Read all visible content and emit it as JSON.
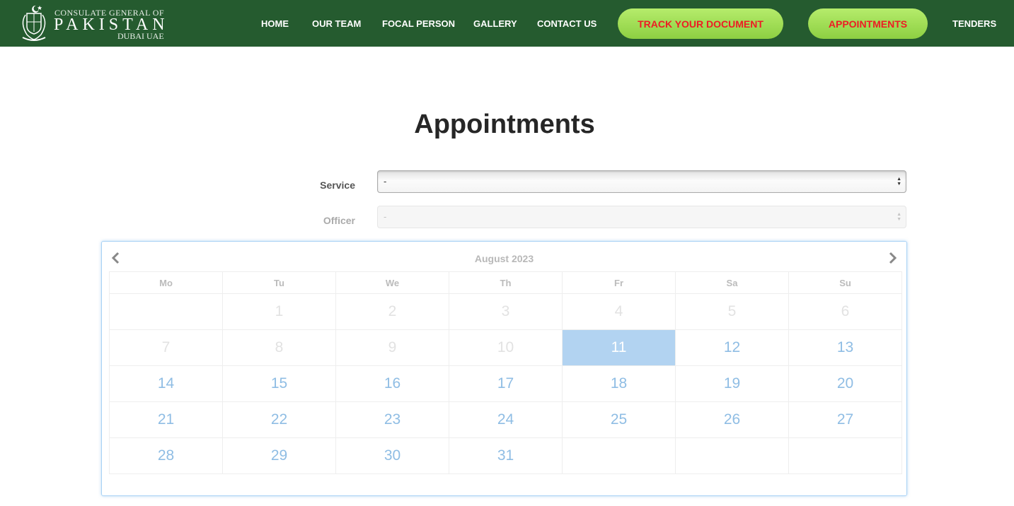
{
  "header": {
    "logo": {
      "line1": "CONSULATE GENERAL OF",
      "line2": "PAKISTAN",
      "line3": "DUBAI UAE"
    },
    "nav": {
      "home": "HOME",
      "our_team": "OUR TEAM",
      "focal_person": "FOCAL PERSON",
      "gallery": "GALLERY",
      "contact_us": "CONTACT US",
      "track": "TRACK YOUR DOCUMENT",
      "appointments": "APPOINTMENTS",
      "tenders": "TENDERS"
    }
  },
  "page": {
    "title": "Appointments"
  },
  "form": {
    "service": {
      "label": "Service",
      "value": "-"
    },
    "officer": {
      "label": "Officer",
      "value": "-",
      "disabled": true
    }
  },
  "calendar": {
    "month": "August 2023",
    "weekdays": [
      "Mo",
      "Tu",
      "We",
      "Th",
      "Fr",
      "Sa",
      "Su"
    ],
    "weeks": [
      [
        "",
        "1",
        "2",
        "3",
        "4",
        "5",
        "6"
      ],
      [
        "7",
        "8",
        "9",
        "10",
        "11",
        "12",
        "13"
      ],
      [
        "14",
        "15",
        "16",
        "17",
        "18",
        "19",
        "20"
      ],
      [
        "21",
        "22",
        "23",
        "24",
        "25",
        "26",
        "27"
      ],
      [
        "28",
        "29",
        "30",
        "31",
        "",
        "",
        ""
      ]
    ],
    "selected": "11",
    "first_available": 11
  },
  "colors": {
    "header_bg": "#255b2f",
    "pill_bg": "#a4e05a",
    "pill_text": "#ed1c24",
    "day_text": "#8fbde4",
    "selected_bg": "#b2d3f1",
    "calendar_border": "#a8d2f5"
  }
}
